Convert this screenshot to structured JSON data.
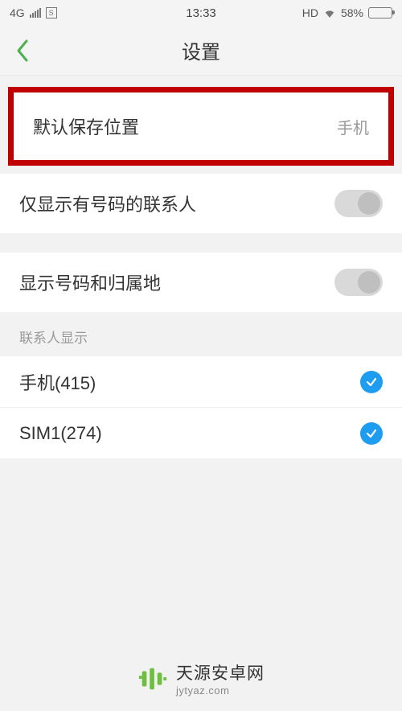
{
  "status_bar": {
    "network_type": "4G",
    "time": "13:33",
    "hd": "HD",
    "battery_percent": "58%"
  },
  "header": {
    "title": "设置"
  },
  "rows": {
    "default_save": {
      "label": "默认保存位置",
      "value": "手机"
    },
    "only_number_contacts": {
      "label": "仅显示有号码的联系人",
      "toggled": false
    },
    "show_number_location": {
      "label": "显示号码和归属地",
      "toggled": false
    }
  },
  "contacts_section": {
    "header": "联系人显示",
    "items": [
      {
        "label": "手机(415)",
        "checked": true
      },
      {
        "label": "SIM1(274)",
        "checked": true
      }
    ]
  },
  "watermark": {
    "line1": "天源安卓网",
    "line2": "jytyaz.com"
  }
}
